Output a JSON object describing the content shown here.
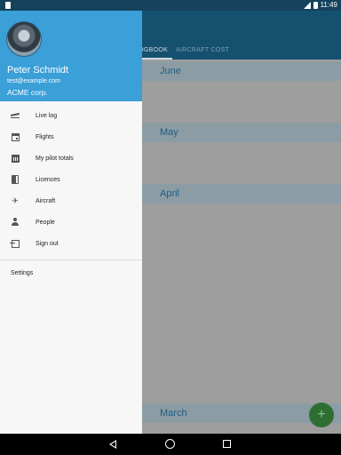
{
  "status_bar": {
    "time": "11:49"
  },
  "background_app": {
    "tabs": [
      "LOGBOOK",
      "AIRCRAFT COST"
    ],
    "months": [
      "June",
      "May",
      "April",
      "March"
    ],
    "fab_label": "+"
  },
  "drawer": {
    "header": {
      "name": "Peter Schmidt",
      "email": "test@example.com",
      "company": "ACME corp."
    },
    "items": [
      {
        "label": "Live log",
        "icon": "flight-takeoff-icon"
      },
      {
        "label": "Flights",
        "icon": "calendar-icon"
      },
      {
        "label": "My pilot totals",
        "icon": "chart-icon"
      },
      {
        "label": "Licences",
        "icon": "book-icon"
      },
      {
        "label": "Aircraft",
        "icon": "airplane-icon"
      },
      {
        "label": "People",
        "icon": "person-icon"
      },
      {
        "label": "Sign out",
        "icon": "exit-icon"
      }
    ],
    "settings_label": "Settings"
  },
  "colors": {
    "header_blue": "#3b9fd8",
    "appbar": "#15506f",
    "fab": "#4caf50"
  }
}
